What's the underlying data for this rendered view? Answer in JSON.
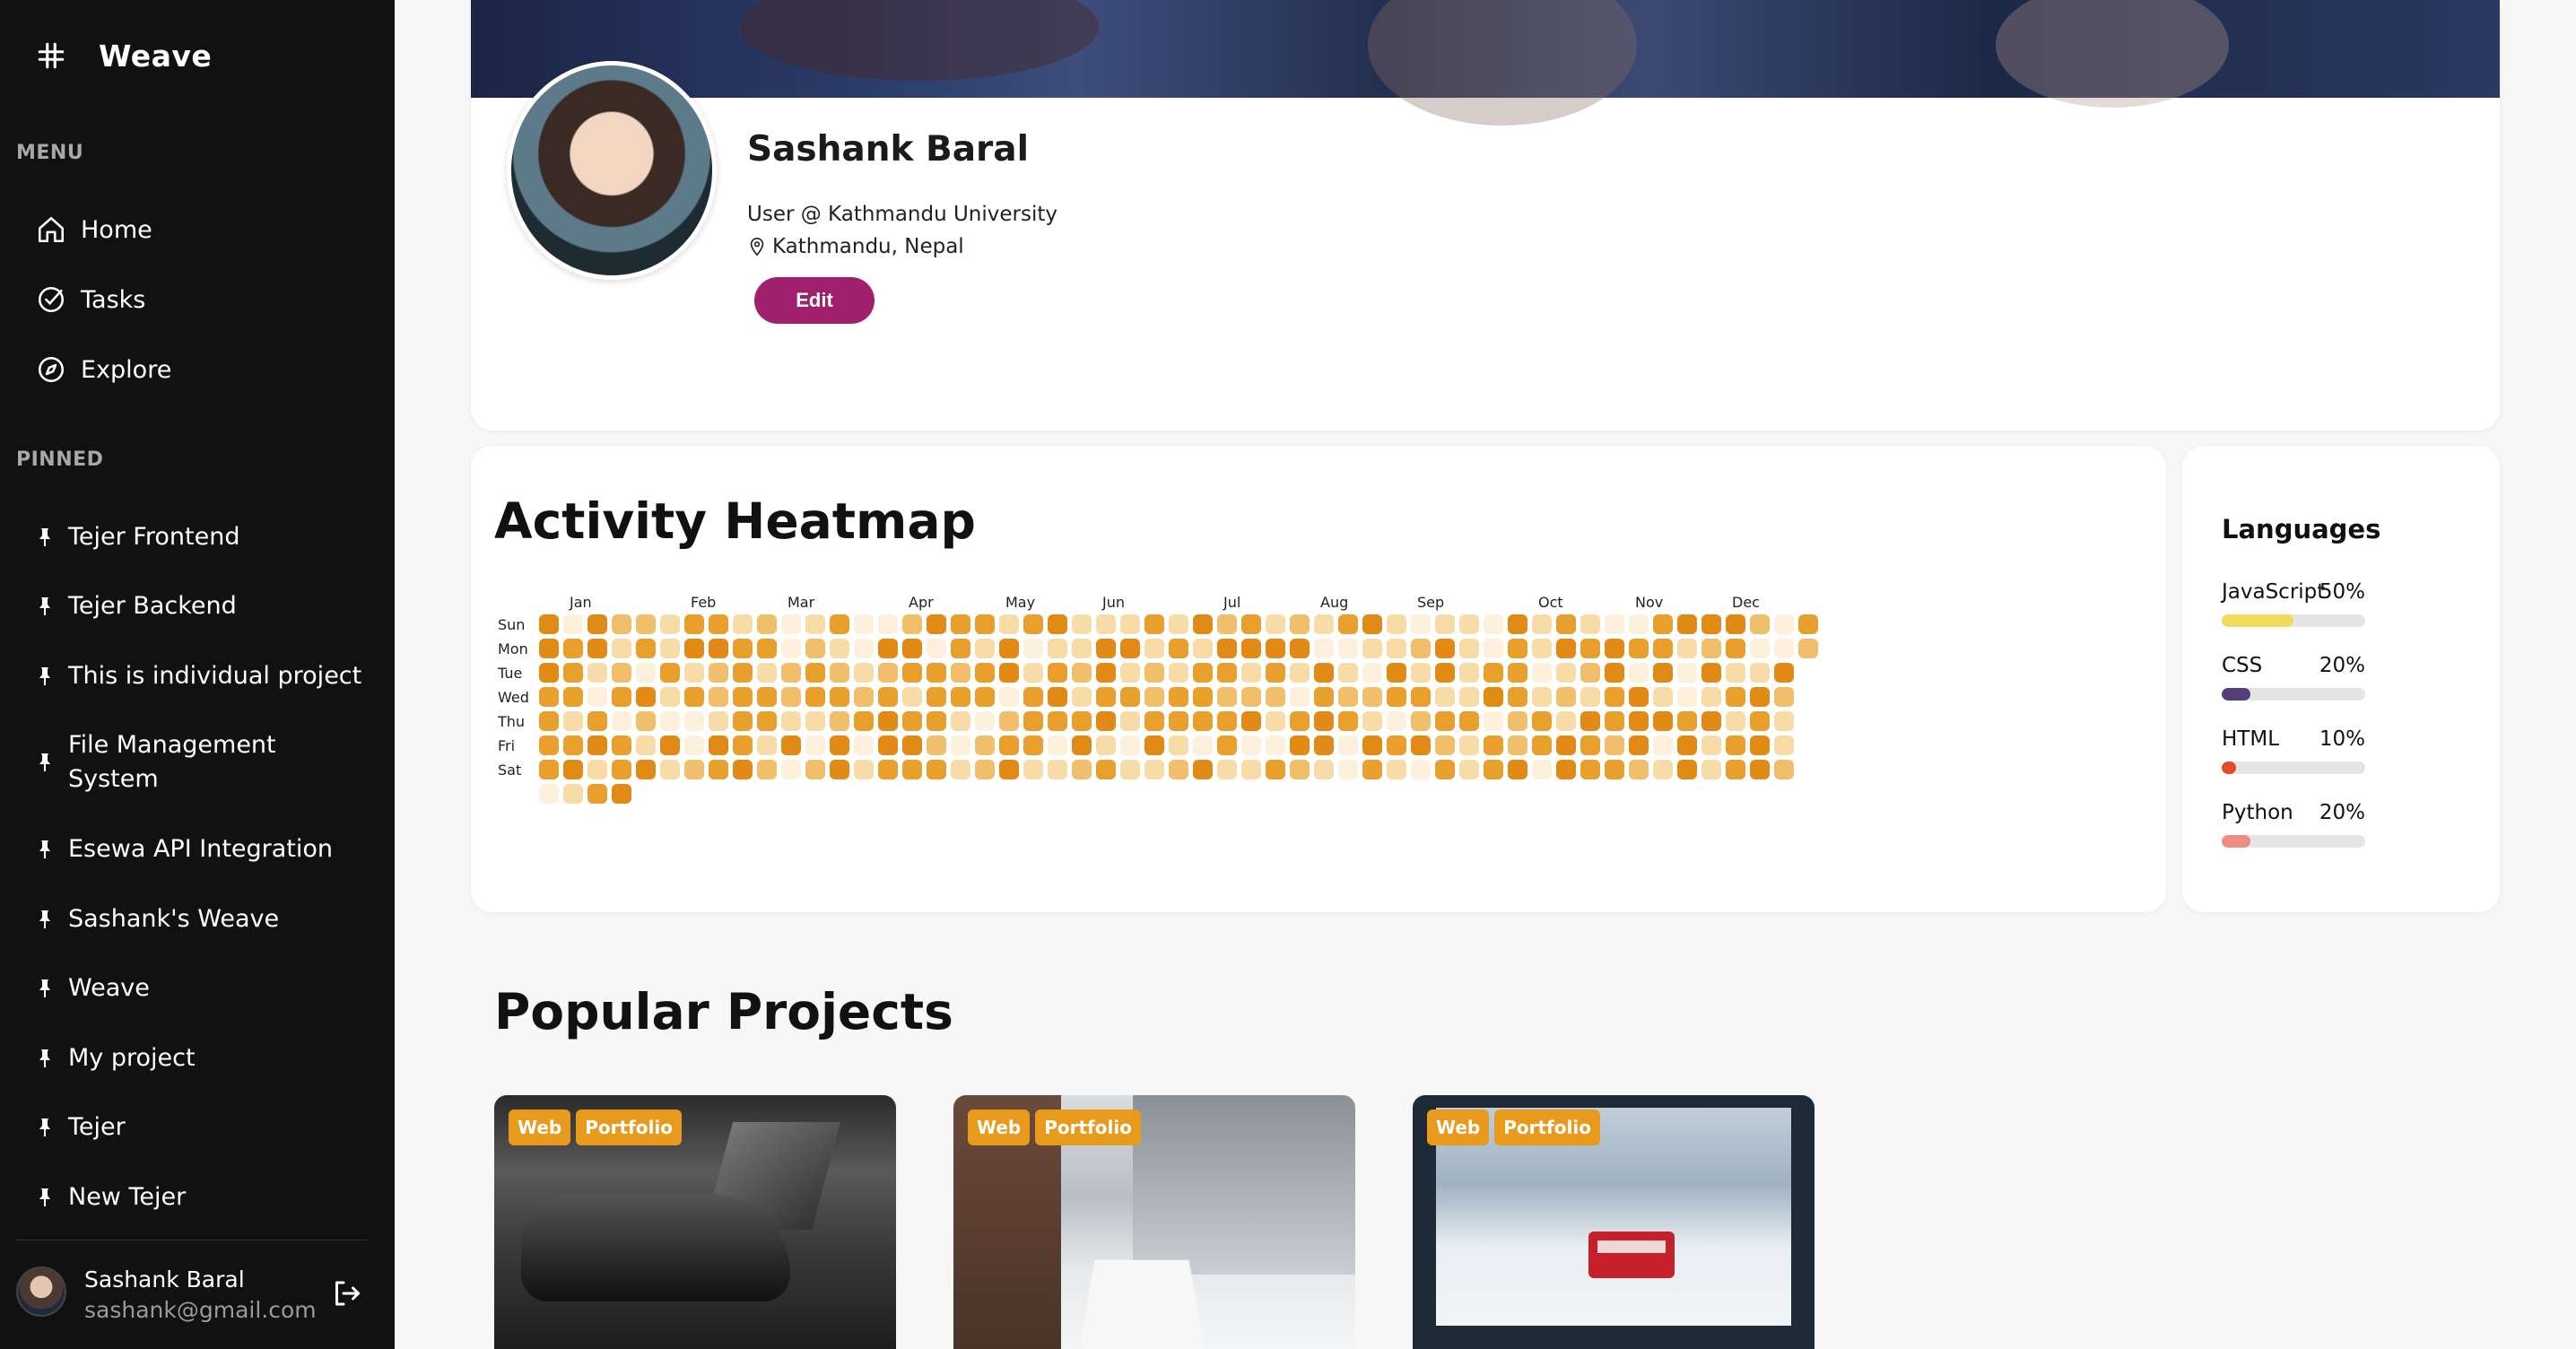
{
  "app": {
    "name": "Weave"
  },
  "sidebar": {
    "menu_label": "MENU",
    "menu": [
      {
        "label": "Home",
        "icon": "home-icon"
      },
      {
        "label": "Tasks",
        "icon": "check-circle-icon"
      },
      {
        "label": "Explore",
        "icon": "compass-icon"
      }
    ],
    "pinned_label": "PINNED",
    "pinned": [
      {
        "label": "Tejer Frontend"
      },
      {
        "label": "Tejer Backend"
      },
      {
        "label": "This is individual project"
      },
      {
        "label": "File Management System"
      },
      {
        "label": "Esewa API Integration"
      },
      {
        "label": "Sashank's Weave"
      },
      {
        "label": "Weave"
      },
      {
        "label": "My project"
      },
      {
        "label": "Tejer"
      },
      {
        "label": "New Tejer"
      }
    ],
    "user": {
      "name": "Sashank Baral",
      "email": "sashank@gmail.com"
    }
  },
  "profile": {
    "name": "Sashank Baral",
    "role": "User @ Kathmandu University",
    "location": "Kathmandu, Nepal",
    "edit_label": "Edit"
  },
  "heatmap": {
    "title": "Activity Heatmap",
    "months": [
      "Jan",
      "Feb",
      "Mar",
      "Apr",
      "May",
      "Jun",
      "Jul",
      "Aug",
      "Sep",
      "Oct",
      "Nov",
      "Dec"
    ],
    "days": [
      "Sun",
      "Mon",
      "Tue",
      "Wed",
      "Thu",
      "Fri",
      "Sat"
    ],
    "colors": [
      "#fdf1de",
      "#f8dca8",
      "#f1bf6c",
      "#e89f2c",
      "#e28a16"
    ]
  },
  "languages": {
    "title": "Languages",
    "items": [
      {
        "name": "JavaScript",
        "percent_label": "50%",
        "value": 0.5,
        "color": "#f0dc5a"
      },
      {
        "name": "CSS",
        "percent_label": "20%",
        "value": 0.2,
        "color": "#563d7c"
      },
      {
        "name": "HTML",
        "percent_label": "10%",
        "value": 0.1,
        "color": "#e34c26"
      },
      {
        "name": "Python",
        "percent_label": "20%",
        "value": 0.2,
        "color": "#ee8c84"
      }
    ]
  },
  "projects": {
    "title": "Popular Projects",
    "items": [
      {
        "tags": [
          "Web",
          "Portfolio"
        ]
      },
      {
        "tags": [
          "Web",
          "Portfolio"
        ]
      },
      {
        "tags": [
          "Web",
          "Portfolio"
        ]
      }
    ]
  }
}
